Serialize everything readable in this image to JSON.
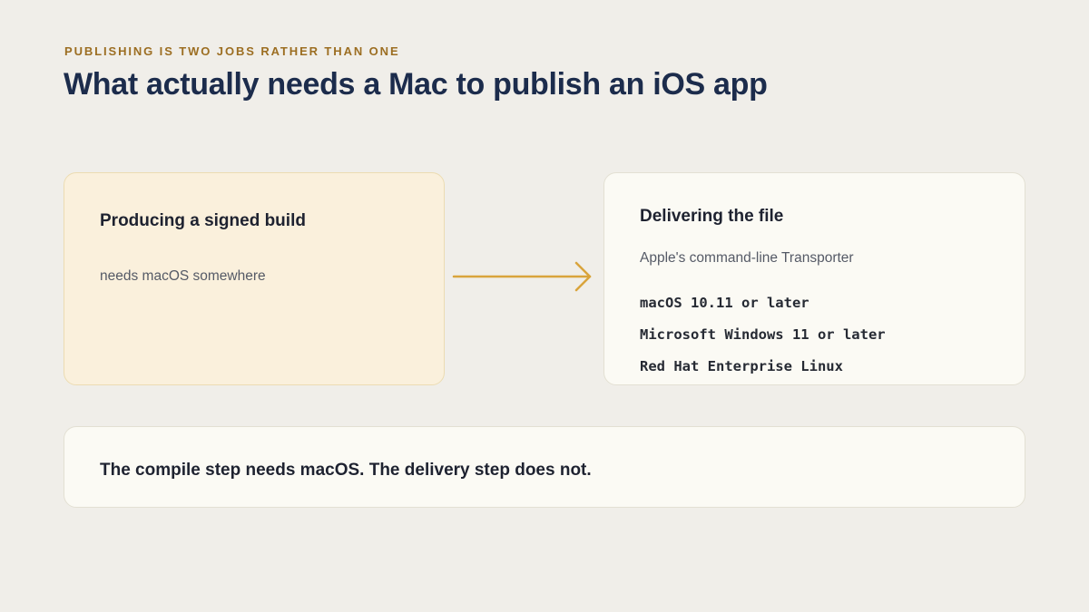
{
  "eyebrow": "PUBLISHING IS TWO JOBS RATHER THAN ONE",
  "title": "What actually needs a Mac to publish an iOS app",
  "build_card": {
    "heading": "Producing a signed build",
    "body": "needs macOS somewhere"
  },
  "delivery_card": {
    "heading": "Delivering the file",
    "subtitle": "Apple's command-line Transporter",
    "platforms": [
      "macOS 10.11 or later",
      "Microsoft Windows 11 or later",
      "Red Hat Enterprise Linux"
    ]
  },
  "summary": "The compile step needs macOS. The delivery step does not.",
  "colors": {
    "background": "#f0eee9",
    "accent": "#d9a43c",
    "eyebrow": "#9c6e22",
    "title": "#1c2c4c",
    "build_card_fill": "#faf0dc",
    "card_fill": "#fbfaf4"
  },
  "icons": {
    "connector": "right-arrow-icon"
  }
}
